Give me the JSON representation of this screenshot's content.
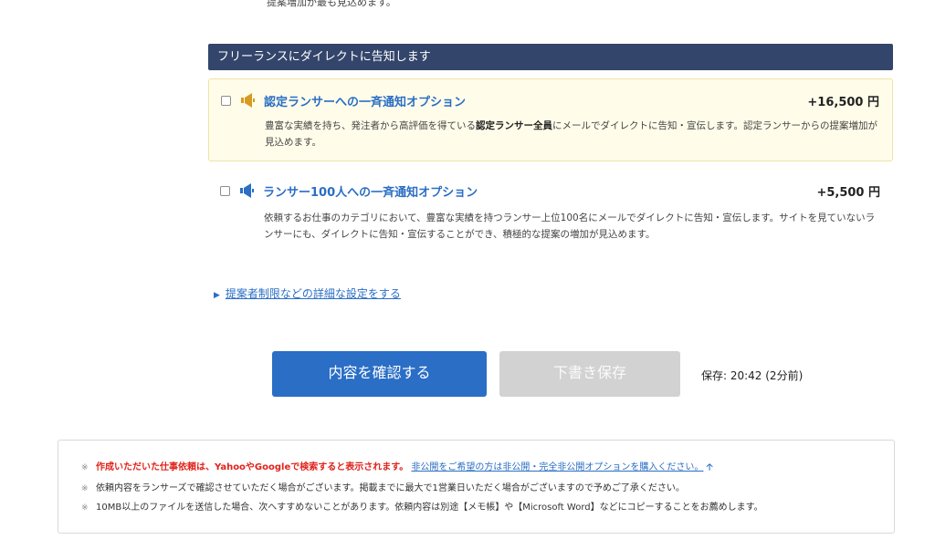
{
  "top_partial_text": "提案増加が最も見込めます。",
  "section_header": "フリーランスにダイレクトに告知します",
  "options": [
    {
      "title": "認定ランサーへの一斉通知オプション",
      "price": "+16,500 円",
      "desc_before": "豊富な実績を持ち、発注者から高評価を得ている",
      "desc_bold": "認定ランサー全員",
      "desc_after": "にメールでダイレクトに告知・宣伝します。認定ランサーからの提案増加が見込めます。"
    },
    {
      "title": "ランサー100人への一斉通知オプション",
      "price": "+5,500 円",
      "desc": "依頼するお仕事のカテゴリにおいて、豊富な実績を持つランサー上位100名にメールでダイレクトに告知・宣伝します。サイトを見ていないランサーにも、ダイレクトに告知・宣伝することができ、積極的な提案の増加が見込めます。"
    }
  ],
  "advanced_link": "提案者制限などの詳細な設定をする",
  "buttons": {
    "confirm": "内容を確認する",
    "draft": "下書き保存"
  },
  "save_status": "保存: 20:42 (2分前)",
  "notes": {
    "mark": "※",
    "n1_red": "作成いただいた仕事依頼は、YahooやGoogleで検索すると表示されます。",
    "n1_link": "非公開をご希望の方は非公開・完全非公開オプションを購入ください。",
    "n2": "依頼内容をランサーズで確認させていただく場合がございます。掲載までに最大で1営業日いただく場合がございますので予めご了承ください。",
    "n3": "10MB以上のファイルを送信した場合、次へすすめないことがあります。依頼内容は別途【メモ帳】や【Microsoft Word】などにコピーすることをお薦めします。"
  },
  "colors": {
    "accent": "#2a6ec5",
    "header_bg": "#33456b",
    "megaphone_gold": "#d79b22",
    "megaphone_blue": "#2a6ec5"
  }
}
